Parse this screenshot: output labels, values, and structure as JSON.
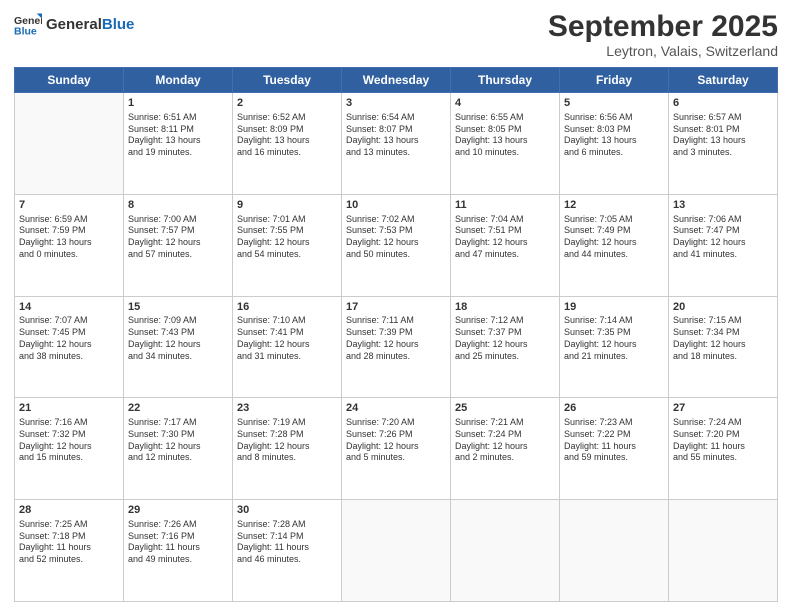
{
  "header": {
    "logo_general": "General",
    "logo_blue": "Blue",
    "month": "September 2025",
    "location": "Leytron, Valais, Switzerland"
  },
  "days_of_week": [
    "Sunday",
    "Monday",
    "Tuesday",
    "Wednesday",
    "Thursday",
    "Friday",
    "Saturday"
  ],
  "weeks": [
    [
      {
        "day": "",
        "info": ""
      },
      {
        "day": "1",
        "info": "Sunrise: 6:51 AM\nSunset: 8:11 PM\nDaylight: 13 hours\nand 19 minutes."
      },
      {
        "day": "2",
        "info": "Sunrise: 6:52 AM\nSunset: 8:09 PM\nDaylight: 13 hours\nand 16 minutes."
      },
      {
        "day": "3",
        "info": "Sunrise: 6:54 AM\nSunset: 8:07 PM\nDaylight: 13 hours\nand 13 minutes."
      },
      {
        "day": "4",
        "info": "Sunrise: 6:55 AM\nSunset: 8:05 PM\nDaylight: 13 hours\nand 10 minutes."
      },
      {
        "day": "5",
        "info": "Sunrise: 6:56 AM\nSunset: 8:03 PM\nDaylight: 13 hours\nand 6 minutes."
      },
      {
        "day": "6",
        "info": "Sunrise: 6:57 AM\nSunset: 8:01 PM\nDaylight: 13 hours\nand 3 minutes."
      }
    ],
    [
      {
        "day": "7",
        "info": "Sunrise: 6:59 AM\nSunset: 7:59 PM\nDaylight: 13 hours\nand 0 minutes."
      },
      {
        "day": "8",
        "info": "Sunrise: 7:00 AM\nSunset: 7:57 PM\nDaylight: 12 hours\nand 57 minutes."
      },
      {
        "day": "9",
        "info": "Sunrise: 7:01 AM\nSunset: 7:55 PM\nDaylight: 12 hours\nand 54 minutes."
      },
      {
        "day": "10",
        "info": "Sunrise: 7:02 AM\nSunset: 7:53 PM\nDaylight: 12 hours\nand 50 minutes."
      },
      {
        "day": "11",
        "info": "Sunrise: 7:04 AM\nSunset: 7:51 PM\nDaylight: 12 hours\nand 47 minutes."
      },
      {
        "day": "12",
        "info": "Sunrise: 7:05 AM\nSunset: 7:49 PM\nDaylight: 12 hours\nand 44 minutes."
      },
      {
        "day": "13",
        "info": "Sunrise: 7:06 AM\nSunset: 7:47 PM\nDaylight: 12 hours\nand 41 minutes."
      }
    ],
    [
      {
        "day": "14",
        "info": "Sunrise: 7:07 AM\nSunset: 7:45 PM\nDaylight: 12 hours\nand 38 minutes."
      },
      {
        "day": "15",
        "info": "Sunrise: 7:09 AM\nSunset: 7:43 PM\nDaylight: 12 hours\nand 34 minutes."
      },
      {
        "day": "16",
        "info": "Sunrise: 7:10 AM\nSunset: 7:41 PM\nDaylight: 12 hours\nand 31 minutes."
      },
      {
        "day": "17",
        "info": "Sunrise: 7:11 AM\nSunset: 7:39 PM\nDaylight: 12 hours\nand 28 minutes."
      },
      {
        "day": "18",
        "info": "Sunrise: 7:12 AM\nSunset: 7:37 PM\nDaylight: 12 hours\nand 25 minutes."
      },
      {
        "day": "19",
        "info": "Sunrise: 7:14 AM\nSunset: 7:35 PM\nDaylight: 12 hours\nand 21 minutes."
      },
      {
        "day": "20",
        "info": "Sunrise: 7:15 AM\nSunset: 7:34 PM\nDaylight: 12 hours\nand 18 minutes."
      }
    ],
    [
      {
        "day": "21",
        "info": "Sunrise: 7:16 AM\nSunset: 7:32 PM\nDaylight: 12 hours\nand 15 minutes."
      },
      {
        "day": "22",
        "info": "Sunrise: 7:17 AM\nSunset: 7:30 PM\nDaylight: 12 hours\nand 12 minutes."
      },
      {
        "day": "23",
        "info": "Sunrise: 7:19 AM\nSunset: 7:28 PM\nDaylight: 12 hours\nand 8 minutes."
      },
      {
        "day": "24",
        "info": "Sunrise: 7:20 AM\nSunset: 7:26 PM\nDaylight: 12 hours\nand 5 minutes."
      },
      {
        "day": "25",
        "info": "Sunrise: 7:21 AM\nSunset: 7:24 PM\nDaylight: 12 hours\nand 2 minutes."
      },
      {
        "day": "26",
        "info": "Sunrise: 7:23 AM\nSunset: 7:22 PM\nDaylight: 11 hours\nand 59 minutes."
      },
      {
        "day": "27",
        "info": "Sunrise: 7:24 AM\nSunset: 7:20 PM\nDaylight: 11 hours\nand 55 minutes."
      }
    ],
    [
      {
        "day": "28",
        "info": "Sunrise: 7:25 AM\nSunset: 7:18 PM\nDaylight: 11 hours\nand 52 minutes."
      },
      {
        "day": "29",
        "info": "Sunrise: 7:26 AM\nSunset: 7:16 PM\nDaylight: 11 hours\nand 49 minutes."
      },
      {
        "day": "30",
        "info": "Sunrise: 7:28 AM\nSunset: 7:14 PM\nDaylight: 11 hours\nand 46 minutes."
      },
      {
        "day": "",
        "info": ""
      },
      {
        "day": "",
        "info": ""
      },
      {
        "day": "",
        "info": ""
      },
      {
        "day": "",
        "info": ""
      }
    ]
  ]
}
